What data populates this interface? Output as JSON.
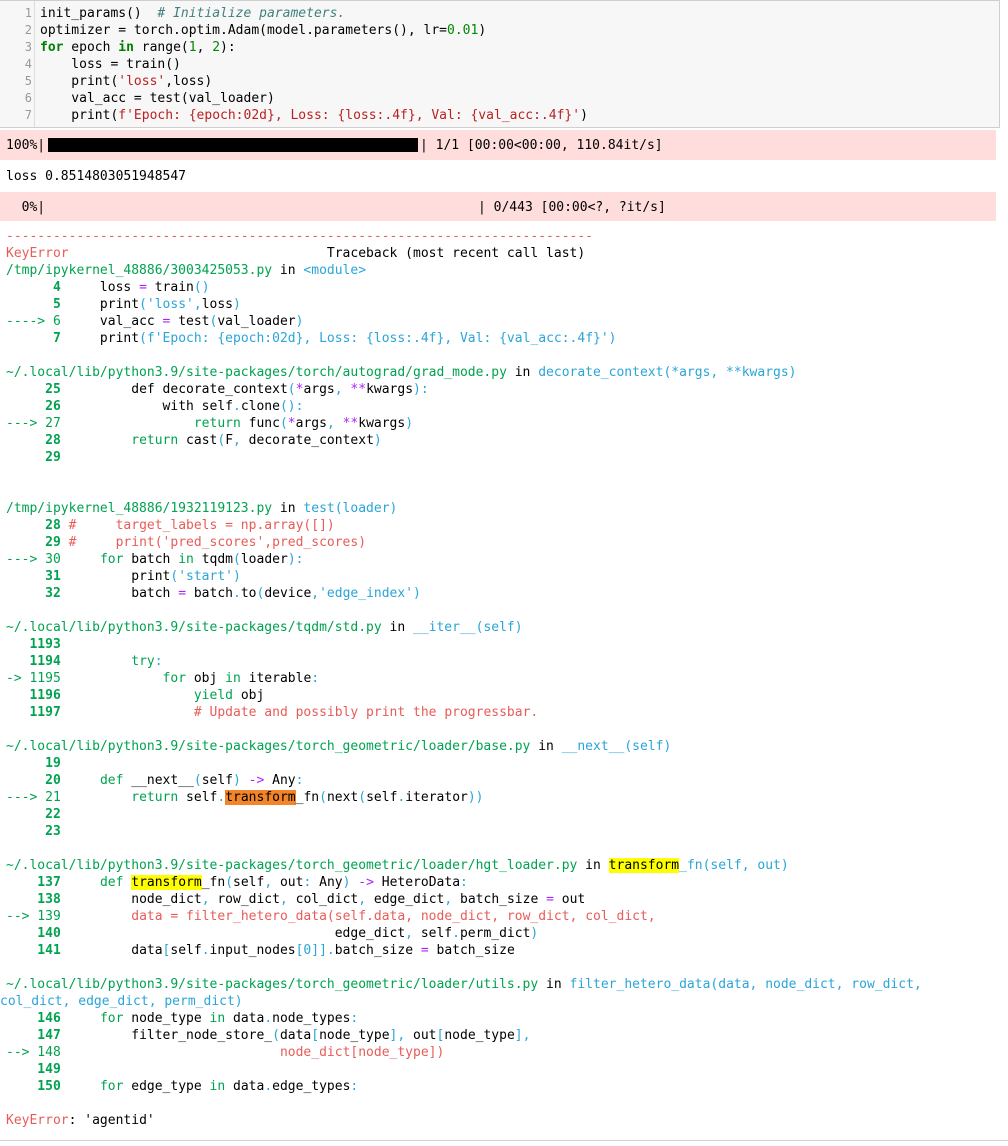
{
  "cell": {
    "line_numbers": [
      "1",
      "2",
      "3",
      "4",
      "5",
      "6",
      "7"
    ],
    "lines": [
      [
        "init_params()  ",
        "# Initialize parameters."
      ],
      [
        "optimizer = torch.optim.Adam(model.parameters(), lr=",
        "0.01",
        ")"
      ],
      [
        "for",
        " epoch ",
        "in",
        " range(",
        "1",
        ", ",
        "2",
        "):"
      ],
      [
        "    loss = train()"
      ],
      [
        "    print(",
        "'loss'",
        ",loss)"
      ],
      [
        "    val_acc = test(val_loader)"
      ],
      [
        "    print(",
        "f'Epoch: {epoch:02d}, Loss: {loss:.4f}, Val: {val_acc:.4f}'",
        ")"
      ]
    ]
  },
  "progress1": {
    "percent_label": "100%|",
    "fraction": 1.0,
    "status": "| 1/1 [00:00<00:00, 110.84it/s]"
  },
  "stream_output": "loss 0.8514803051948547",
  "progress2": {
    "percent_label": "  0%|",
    "fraction": 0.0,
    "status": "| 0/443 [00:00<?, ?it/s]"
  },
  "traceback": {
    "separator": "---------------------------------------------------------------------------",
    "error_name": "KeyError",
    "header_right": "Traceback (most recent call last)",
    "final_error_name": "KeyError",
    "final_error_message": ": 'agentid'"
  },
  "colors": {
    "error_red": "#e75c58",
    "location_green": "#00a250",
    "func_cyan": "#2aa5d8",
    "progress_bg": "#ffdddd",
    "highlight_orange": "#f2852a",
    "highlight_yellow": "#ffff00"
  }
}
